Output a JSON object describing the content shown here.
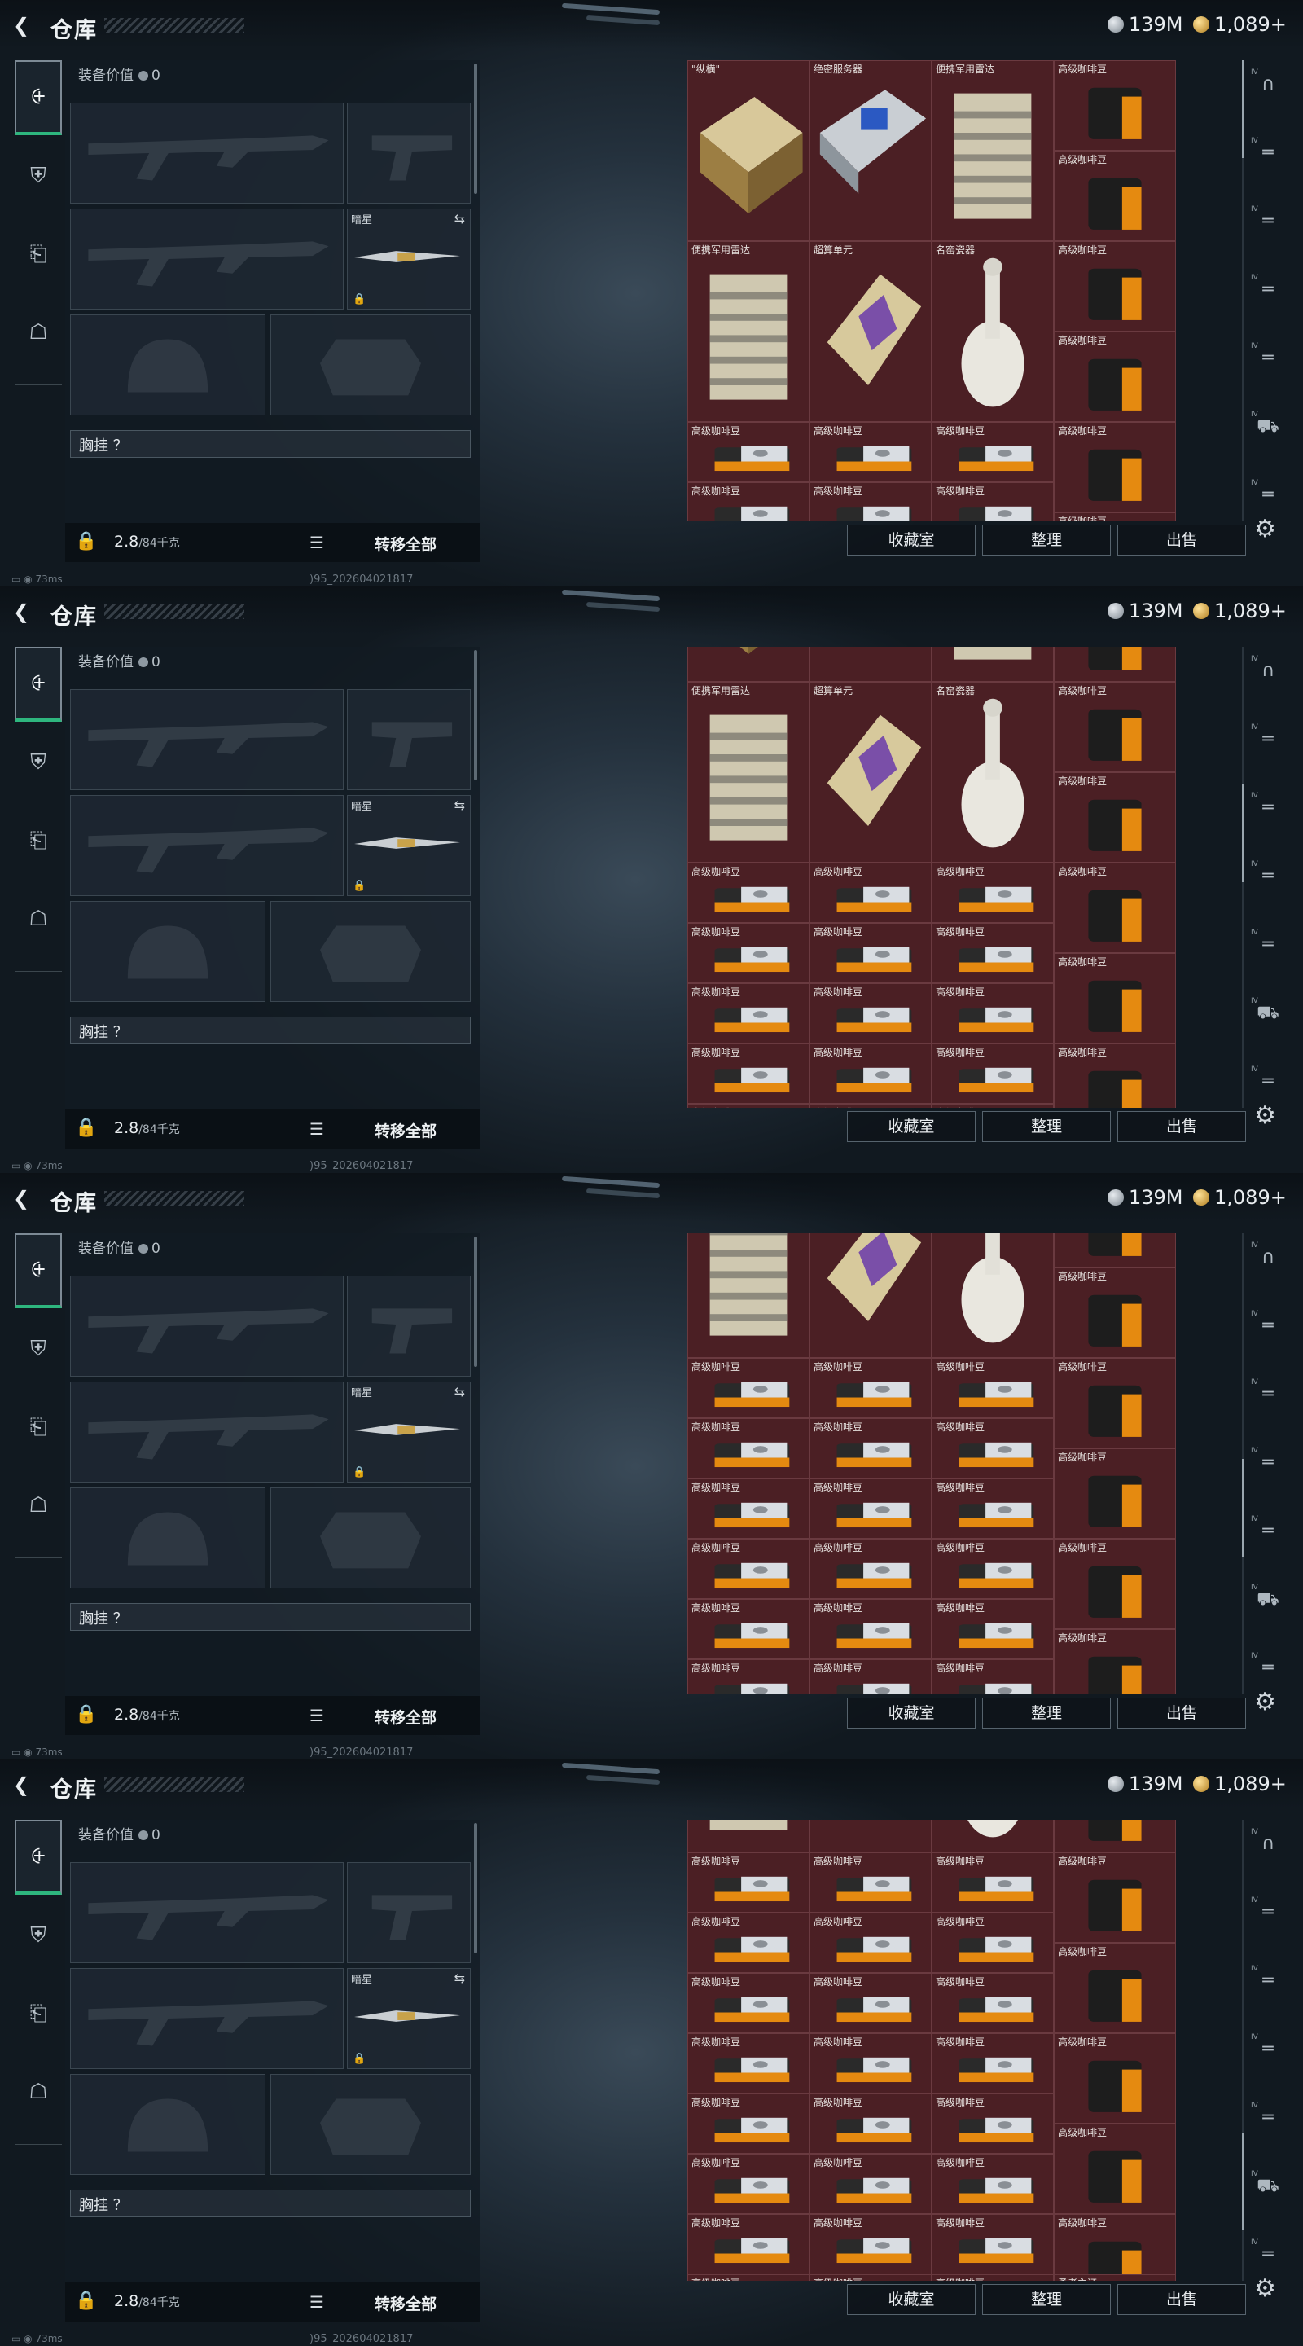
{
  "header": {
    "back_icon": "back-arrow-icon",
    "title": "仓库",
    "silver": "139M",
    "gold": "1,089+"
  },
  "nav": {
    "items": [
      "weapon-icon",
      "backpack-icon",
      "clipboard-icon",
      "toolbox-icon"
    ]
  },
  "loadout": {
    "equipment_value_label": "装备价值",
    "equipment_value": "0",
    "melee_label": "暗星",
    "chest_label": "胸挂 ？",
    "weight": "2.8",
    "weight_cap": "/84千克",
    "transfer_all": "转移全部"
  },
  "items": {
    "chess": "\"纵横\"",
    "server": "绝密服务器",
    "radar": "便携军用雷达",
    "superunit": "超算单元",
    "vase": "名窑瓷器",
    "coffee": "高级咖啡豆",
    "hero": "勇者之证"
  },
  "buttons": {
    "collection": "收藏室",
    "sort": "整理",
    "sell": "出售"
  },
  "status": {
    "ping": "73ms",
    "build": ")95_202604021817"
  },
  "right_icons": [
    "helmet-icon",
    "rifle-slot-icon",
    "rifle-slot-icon",
    "rifle-slot-icon",
    "rifle-slot-icon",
    "vehicle-icon",
    "rifle-slot-icon"
  ],
  "right_icon_tag": "IV",
  "colors": {
    "grid_cell": "#4b1f24",
    "active_green": "#2eb67e"
  },
  "scroll_positions": [
    0,
    0.38,
    0.62,
    0.86
  ]
}
